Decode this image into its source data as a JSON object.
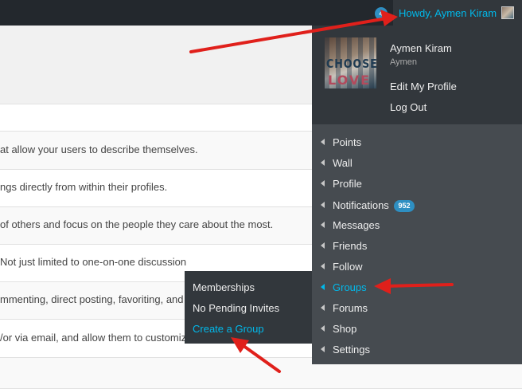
{
  "admin_bar": {
    "notification_count": "4",
    "howdy": "Howdy, Aymen Kiram"
  },
  "account": {
    "display_name": "Aymen Kiram",
    "username": "Aymen",
    "edit_profile": "Edit My Profile",
    "logout": "Log Out",
    "avatar_text": [
      "CHOOSE",
      "LOVE"
    ]
  },
  "bp_menu": {
    "items": [
      {
        "label": "Points"
      },
      {
        "label": "Wall"
      },
      {
        "label": "Profile"
      },
      {
        "label": "Notifications",
        "badge": "952"
      },
      {
        "label": "Messages"
      },
      {
        "label": "Friends"
      },
      {
        "label": "Follow"
      },
      {
        "label": "Groups",
        "active": true
      },
      {
        "label": "Forums"
      },
      {
        "label": "Shop"
      },
      {
        "label": "Settings"
      }
    ]
  },
  "groups_submenu": {
    "items": [
      {
        "label": "Memberships"
      },
      {
        "label": "No Pending Invites"
      },
      {
        "label": "Create a Group"
      }
    ]
  },
  "list_rows": [
    "at allow your users to describe themselves.",
    "ngs directly from within their profiles.",
    " of others and focus on the people they care about the most.",
    "Not just limited to one-on-one discussion",
    "mmenting, direct posting, favoriting, and",
    "/or via email, and allow them to customize their notification settings."
  ],
  "colors": {
    "admin_bar": "#23282d",
    "submenu": "#32373c",
    "menu": "#464b50",
    "accent": "#00b9eb",
    "annotation": "#e0201b"
  }
}
